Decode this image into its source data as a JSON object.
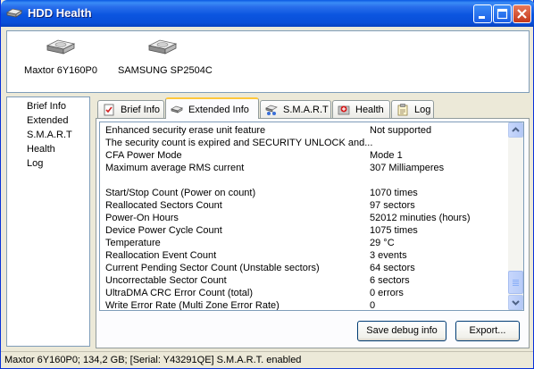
{
  "window": {
    "title": "HDD Health"
  },
  "drives": [
    {
      "label": "Maxtor 6Y160P0"
    },
    {
      "label": "SAMSUNG SP2504C"
    }
  ],
  "nav": {
    "items": [
      "Brief Info",
      "Extended",
      "S.M.A.R.T",
      "Health",
      "Log"
    ]
  },
  "tabs": [
    {
      "label": "Brief Info",
      "icon": "checklist-icon"
    },
    {
      "label": "Extended Info",
      "icon": "drive-icon",
      "active": true
    },
    {
      "label": "S.M.A.R.T",
      "icon": "network-drive-icon"
    },
    {
      "label": "Health",
      "icon": "health-icon"
    },
    {
      "label": "Log",
      "icon": "log-icon"
    }
  ],
  "extended_info": {
    "rows": [
      {
        "key": "Enhanced security erase unit feature",
        "value": "Not supported"
      },
      {
        "key": "The security count is expired and SECURITY UNLOCK and...",
        "value": ""
      },
      {
        "key": "CFA Power Mode",
        "value": "Mode 1"
      },
      {
        "key": "Maximum average RMS current",
        "value": "307 Milliamperes"
      },
      {
        "key": "",
        "value": ""
      },
      {
        "key": "Start/Stop Count (Power on count)",
        "value": "1070 times"
      },
      {
        "key": "Reallocated Sectors Count",
        "value": "97 sectors"
      },
      {
        "key": "Power-On Hours",
        "value": "52012 minuties (hours)"
      },
      {
        "key": "Device Power Cycle Count",
        "value": "1075 times"
      },
      {
        "key": "Temperature",
        "value": "29 °C"
      },
      {
        "key": "Reallocation Event Count",
        "value": "3 events"
      },
      {
        "key": "Current Pending Sector Count (Unstable sectors)",
        "value": "64 sectors"
      },
      {
        "key": "Uncorrectable Sector Count",
        "value": "6 sectors"
      },
      {
        "key": "UltraDMA CRC Error Count (total)",
        "value": "0 errors"
      },
      {
        "key": "Write Error Rate (Multi Zone Error Rate)",
        "value": "0"
      }
    ]
  },
  "buttons": {
    "save_debug": "Save debug info",
    "export": "Export..."
  },
  "status": {
    "text": "Maxtor 6Y160P0;  134,2 GB;  [Serial: Y43291QE]   S.M.A.R.T. enabled"
  },
  "colors": {
    "titlebar": "#0A4FD8",
    "active_tab_accent": "#FFC83C",
    "close_button": "#C4381A"
  }
}
